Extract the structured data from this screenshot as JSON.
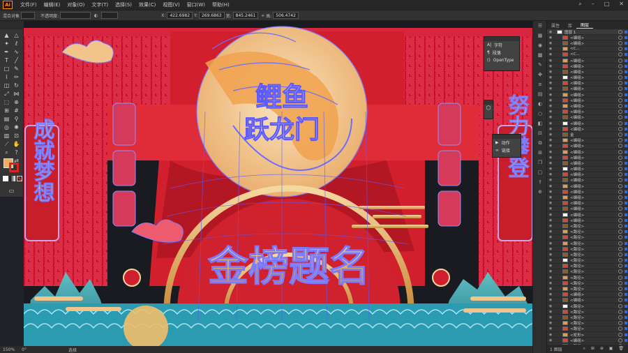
{
  "app": {
    "logo": "Ai"
  },
  "menu": [
    "文件(F)",
    "编辑(E)",
    "对象(O)",
    "文字(T)",
    "选择(S)",
    "效果(C)",
    "视图(V)",
    "窗口(W)",
    "帮助(H)"
  ],
  "control": {
    "selection": "混合对象",
    "opacity_label": "不透明度:",
    "x_label": "X:",
    "x_value": "422.6982",
    "y_label": "Y:",
    "y_value": "269.6863",
    "w_label": "宽:",
    "w_value": "845.2461",
    "h_label": "高:",
    "h_value": "506.4742"
  },
  "artwork": {
    "title_line1": "鲤鱼",
    "title_line2": "跃龙门",
    "center_text": "金榜题名",
    "left_text": "成就梦想",
    "right_text": "努力攀登"
  },
  "panels": {
    "type": {
      "char": "字符",
      "para": "段落",
      "opentype": "OpenType"
    },
    "actions": {
      "actions": "动作",
      "links": "链接"
    }
  },
  "layers": {
    "tabs": [
      "属性",
      "库",
      "图层"
    ],
    "top_layer": "图层 1",
    "rows": [
      "图层 1",
      "<编组>",
      "<编组>",
      "<C...",
      "<C...",
      "<编组>",
      "<编组>",
      "<编组>",
      "<编组>",
      "<编组>",
      "<编组>",
      "<编组>",
      "<编组>",
      "<编组>",
      "<编组>",
      "<编组>",
      "<编组>",
      "<编组>",
      "金",
      "<编组>",
      "<编组>",
      "<编组>",
      "<编组>",
      "<编组>",
      "<编组>",
      "<编组>",
      "<编组>",
      "<编组>",
      "<编组>",
      "<编组>",
      "<编组>",
      "<编组>",
      "<编组>",
      "<编组>",
      "<路径>",
      "<路径>",
      "<路径>",
      "<路径>",
      "<路径>",
      "<路径>",
      "<路径>",
      "<路径>",
      "<路径>",
      "<路径>",
      "<路径>",
      "<路径>",
      "<编组>",
      "<编组>",
      "<路径>",
      "<路径>",
      "<路径>",
      "<路径>",
      "<路径>",
      "<矩形>",
      "<编组>",
      "<路径>"
    ],
    "footer": "1 图层"
  },
  "status": {
    "zoom": "150%",
    "angle": "0°",
    "tool": "选择"
  }
}
